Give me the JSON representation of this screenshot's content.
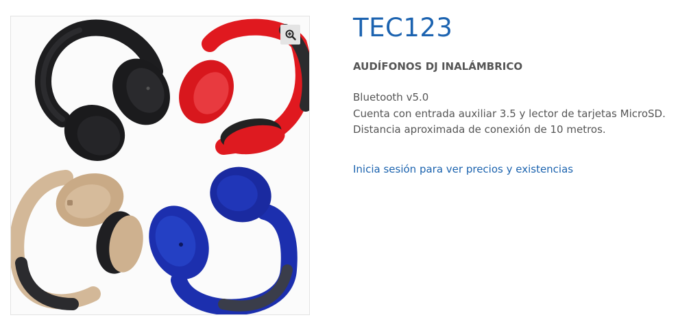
{
  "product": {
    "code": "TEC123",
    "name": "AUDÍFONOS DJ INALÁMBRICO",
    "features": [
      "Bluetooth v5.0",
      "Cuenta con entrada auxiliar 3.5 y lector de tarjetas MicroSD.",
      "Distancia aproximada de conexión de 10 metros."
    ],
    "login_link": "Inicia sesión para ver precios y existencias"
  },
  "gallery": {
    "image_subject": "headphones",
    "zoom_icon": "zoom-in-icon",
    "headphone_colors": [
      "#1d1d1f",
      "#e0191f",
      "#d1b594",
      "#1c2fae"
    ]
  },
  "colors": {
    "title": "#1c63b0",
    "link": "#1a62ae",
    "text": "#555555"
  }
}
